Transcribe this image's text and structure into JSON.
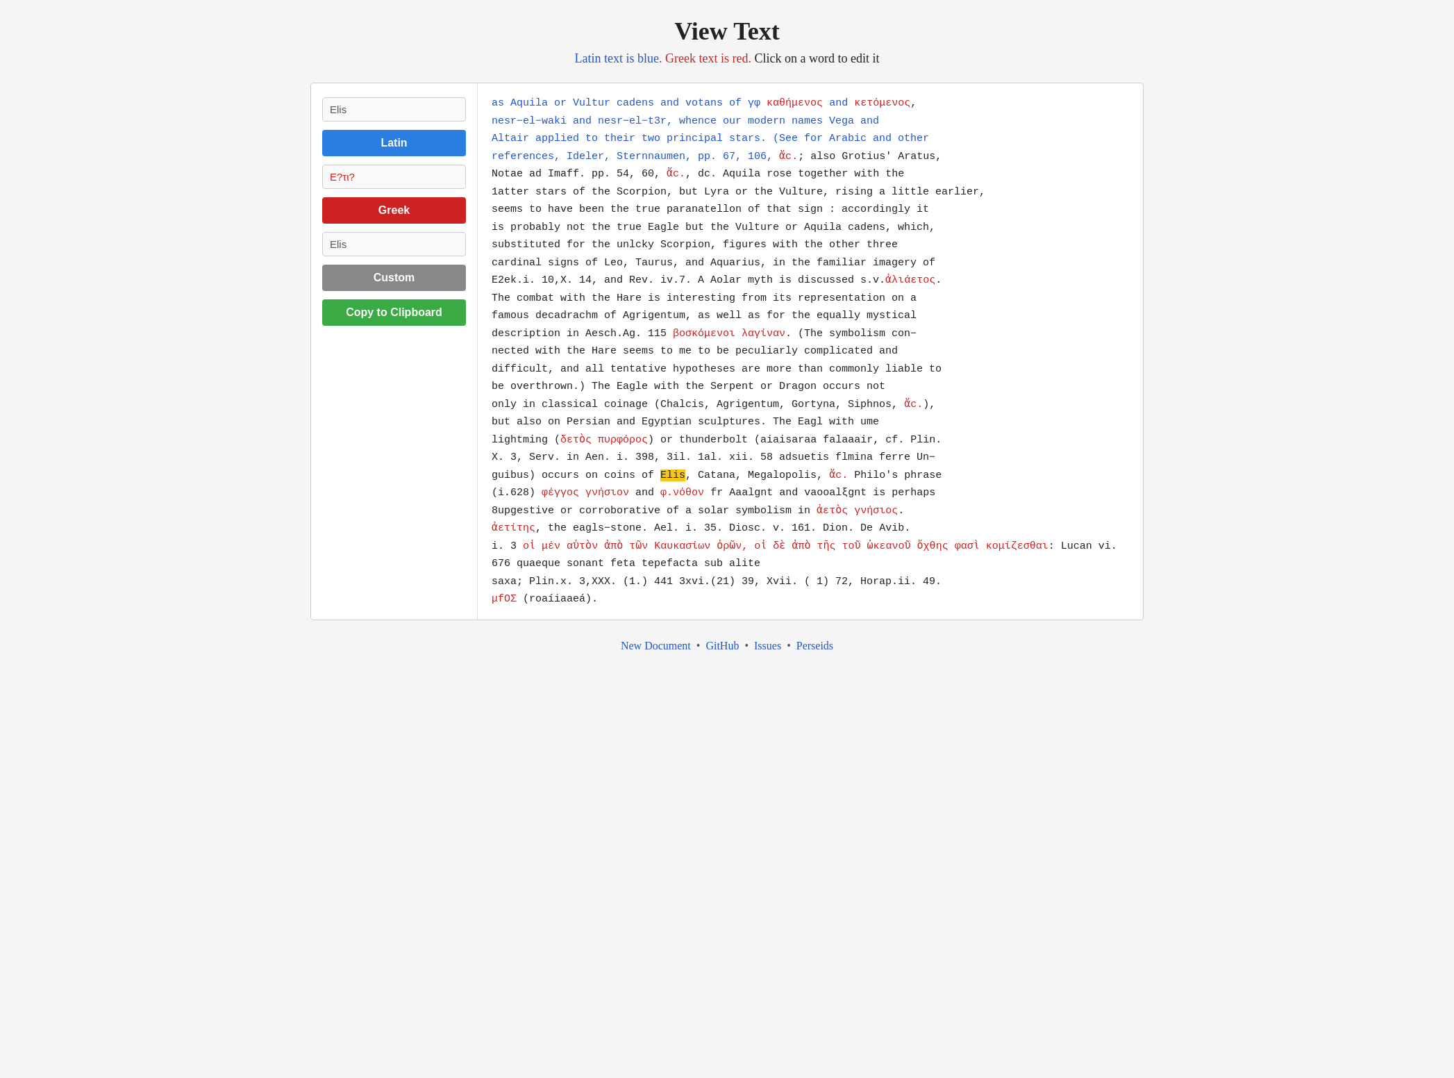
{
  "header": {
    "title": "View Text",
    "subtitle_latin": "Latin text is blue.",
    "subtitle_greek": "Greek text is red.",
    "subtitle_note": "Click on a word to edit it"
  },
  "sidebar": {
    "latin_input_value": "Elis",
    "latin_input_placeholder": "Elis",
    "latin_button": "Latin",
    "greek_input_value": "Ε?τι?",
    "greek_input_placeholder": "Ε?τι?",
    "greek_button": "Greek",
    "custom_input_value": "Elis",
    "custom_input_placeholder": "Elis",
    "custom_button": "Custom",
    "clipboard_button": "Copy to Clipboard"
  },
  "footer": {
    "new_document": "New Document",
    "github": "GitHub",
    "issues": "Issues",
    "perseids": "Perseids"
  }
}
